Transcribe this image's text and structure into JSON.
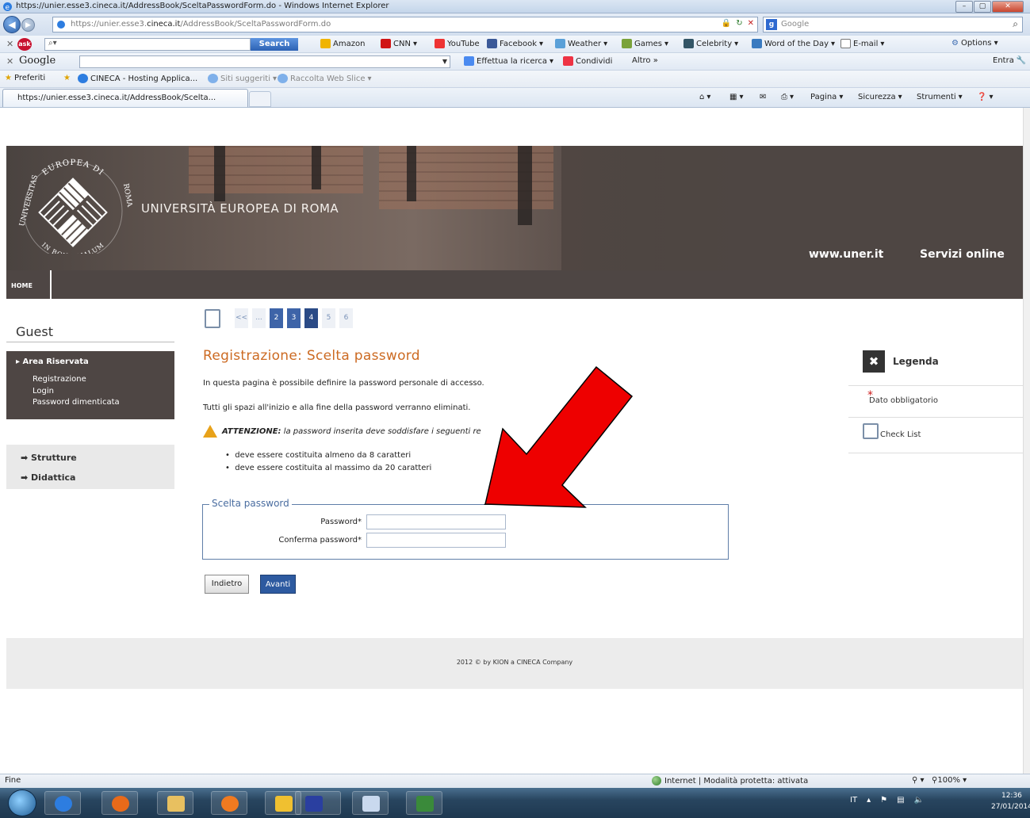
{
  "window": {
    "title": "https://unier.esse3.cineca.it/AddressBook/SceltaPasswordForm.do - Windows Internet Explorer"
  },
  "address_bar": {
    "url_prefix": "https://unier.esse3.",
    "url_host": "cineca.it",
    "url_path": "/AddressBook/SceltaPasswordForm.do",
    "search_placeholder": "Google"
  },
  "ask_toolbar": {
    "search_label": "Search",
    "items": [
      "Amazon",
      "CNN",
      "YouTube",
      "Facebook",
      "Weather",
      "Games",
      "Celebrity",
      "Word of the Day",
      "E-mail"
    ],
    "options_label": "Options"
  },
  "google_toolbar": {
    "logo": "Google",
    "search_label": "Effettua la ricerca",
    "share_label": "Condividi",
    "more_label": "Altro »",
    "signin_label": "Entra"
  },
  "favorites_bar": {
    "favorites_label": "Preferiti",
    "items": [
      "CINECA - Hosting Applica...",
      "Siti suggeriti",
      "Raccolta Web Slice"
    ]
  },
  "tab": {
    "title": "https://unier.esse3.cineca.it/AddressBook/Scelta...",
    "commands": [
      "Pagina",
      "Sicurezza",
      "Strumenti"
    ]
  },
  "site": {
    "university_name": "UNIVERSITÀ EUROPEA DI ROMA",
    "seal_top": "EUROPEA DI",
    "seal_left": "UNIVERSITAS",
    "seal_bottom": "IN BONO MALUM",
    "seal_right": "ROMA",
    "link": "www.uner.it",
    "servizi": "Servizi online",
    "menu_home": "HOME"
  },
  "sidebar": {
    "guest": "Guest",
    "area_head": "Area Riservata",
    "area_items": [
      "Registrazione",
      "Login",
      "Password dimenticata"
    ],
    "sections": [
      "Strutture",
      "Didattica"
    ]
  },
  "pager": {
    "items": [
      "<<",
      "...",
      "2",
      "3",
      "4",
      "5",
      "6"
    ],
    "current": "4"
  },
  "main": {
    "heading": "Registrazione: Scelta password",
    "p1": "In questa pagina è possibile definire la password personale di accesso.",
    "p2": "Tutti gli spazi all'inizio e alla fine della password verranno eliminati.",
    "attention_label": "ATTENZIONE:",
    "attention_text": " la password inserita deve soddisfare i seguenti re",
    "rules": [
      "deve essere costituita almeno da 8 caratteri",
      "deve essere costituita al massimo da 20 caratteri"
    ],
    "fieldset_legend": "Scelta password",
    "password_label": "Password*",
    "confirm_label": "Conferma password*",
    "back_button": "Indietro",
    "next_button": "Avanti"
  },
  "legend_panel": {
    "title": "Legenda",
    "required": "Dato obbligatorio",
    "checklist": "Check List"
  },
  "footer": {
    "text": "2012 © by KION a CINECA Company"
  },
  "status": {
    "left": "Fine",
    "zone": "Internet | Modalità protetta: attivata",
    "zoom": "100%"
  },
  "taskbar": {
    "lang": "IT",
    "time": "12:36",
    "date": "27/01/2014"
  },
  "colors": {
    "heading": "#cc6a22",
    "banner": "#4e4644",
    "button_blue": "#2d5aa0",
    "arrow": "#ee0000"
  }
}
